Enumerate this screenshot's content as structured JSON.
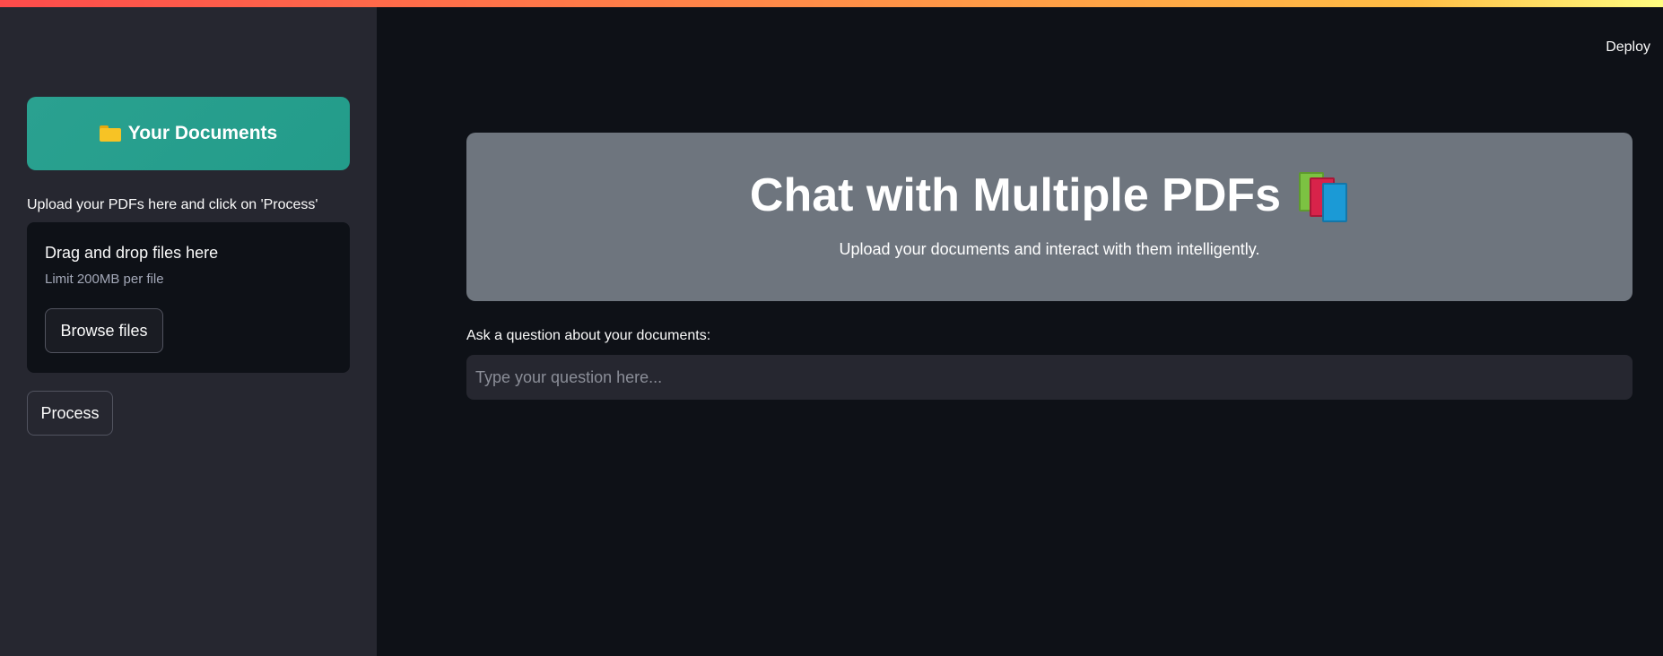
{
  "header": {
    "deploy_label": "Deploy"
  },
  "sidebar": {
    "title_icon": "folder-icon",
    "title": "Your Documents",
    "upload_label": "Upload your PDFs here and click on 'Process'",
    "dropzone": {
      "title": "Drag and drop files here",
      "limit": "Limit 200MB per file",
      "browse_label": "Browse files"
    },
    "process_label": "Process"
  },
  "main": {
    "hero": {
      "title": "Chat with Multiple PDFs",
      "title_icon": "books-icon",
      "subtitle": "Upload your documents and interact with them intelligently."
    },
    "question": {
      "label": "Ask a question about your documents:",
      "placeholder": "Type your question here...",
      "value": ""
    }
  },
  "colors": {
    "background": "#0e1117",
    "sidebar": "#262730",
    "accent_teal": "#2aa190",
    "hero_panel": "#6e757e"
  }
}
